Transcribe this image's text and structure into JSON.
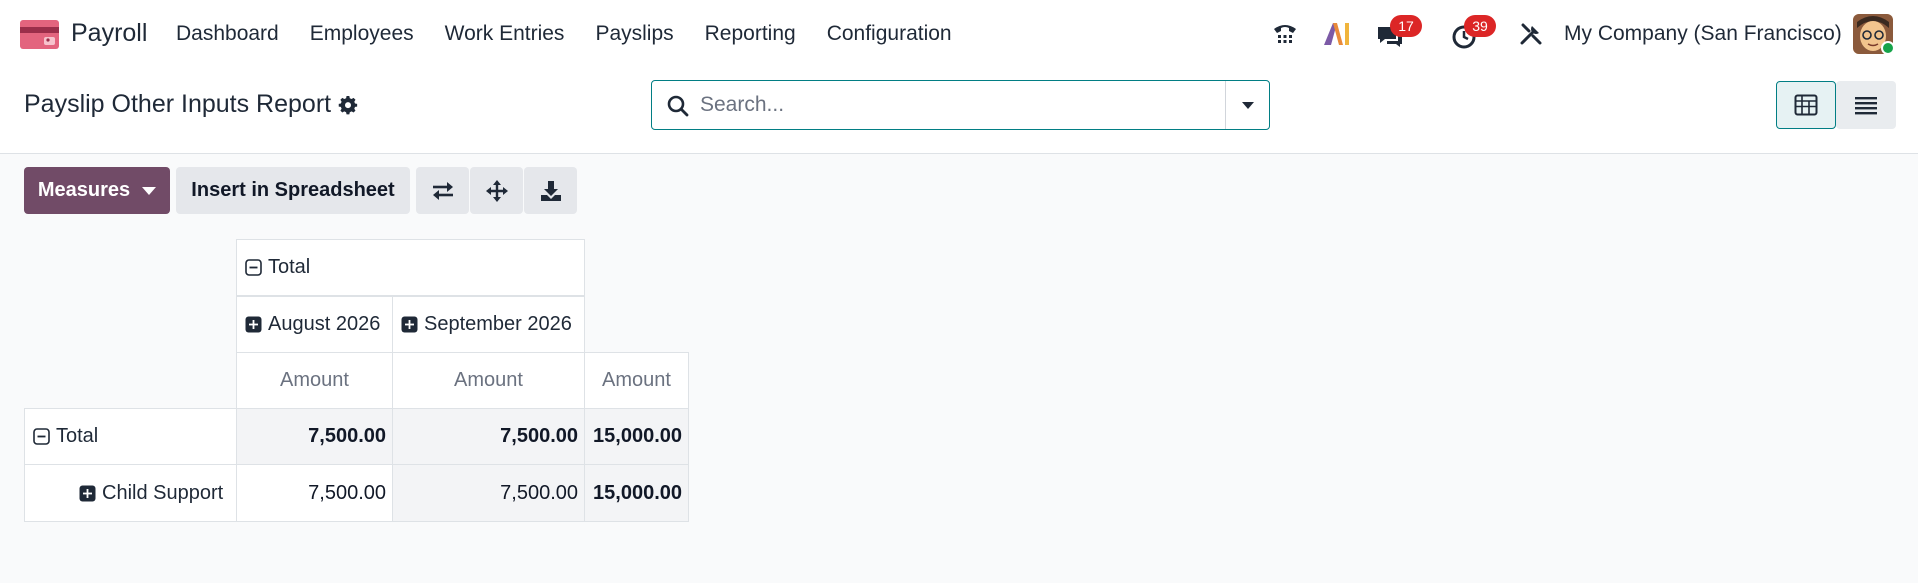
{
  "navbar": {
    "app_name": "Payroll",
    "menu": [
      "Dashboard",
      "Employees",
      "Work Entries",
      "Payslips",
      "Reporting",
      "Configuration"
    ],
    "messages_count": "17",
    "activities_count": "39",
    "company": "My Company (San Francisco)"
  },
  "control": {
    "title": "Payslip Other Inputs Report",
    "search_placeholder": "Search..."
  },
  "toolbar": {
    "measures_label": "Measures",
    "insert_label": "Insert in Spreadsheet"
  },
  "pivot": {
    "col_total_label": "Total",
    "col_groups": [
      "August 2026",
      "September 2026"
    ],
    "measure_label": "Amount",
    "rows": [
      {
        "label": "Total",
        "values": [
          "7,500.00",
          "7,500.00",
          "15,000.00"
        ]
      },
      {
        "label": "Child Support",
        "values": [
          "7,500.00",
          "7,500.00",
          "15,000.00"
        ]
      }
    ]
  },
  "colors": {
    "brand": "#714b67",
    "accent": "#017e84",
    "badge": "#dc2626"
  }
}
